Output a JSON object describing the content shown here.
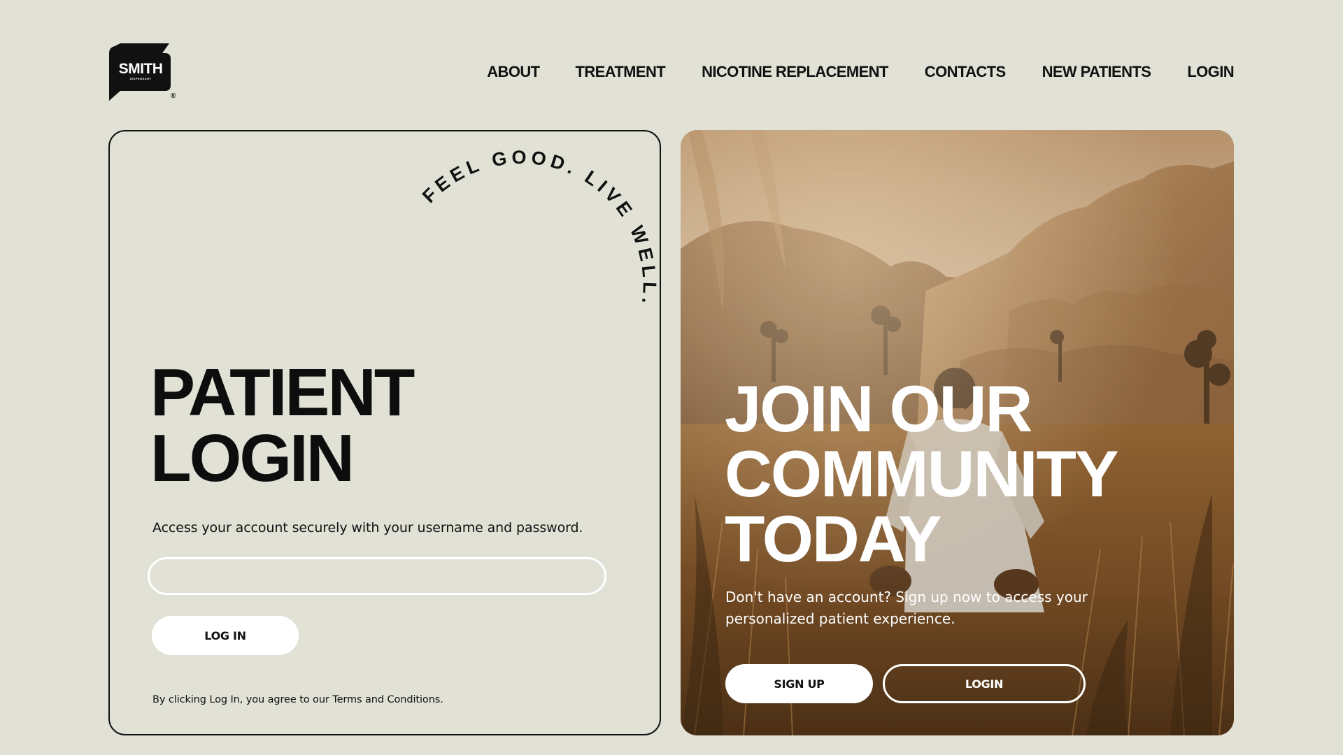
{
  "brand": {
    "logo_main": "SMITH",
    "logo_sub": "DISPENSARY",
    "logo_reg": "®"
  },
  "nav": {
    "items": [
      {
        "label": "ABOUT"
      },
      {
        "label": "TREATMENT"
      },
      {
        "label": "NICOTINE REPLACEMENT"
      },
      {
        "label": "CONTACTS"
      },
      {
        "label": "NEW PATIENTS"
      },
      {
        "label": "LOGIN"
      }
    ]
  },
  "login": {
    "tagline": "FEEL GOOD. LIVE WELL.",
    "title_line1": "PATIENT",
    "title_line2": "LOGIN",
    "description": "Access your account securely with your username and password.",
    "username_value": "",
    "login_button": "LOG IN",
    "terms": "By clicking Log In, you agree to our Terms and Conditions."
  },
  "community": {
    "title_line1": "JOIN OUR",
    "title_line2": "COMMUNITY",
    "title_line3": "TODAY",
    "description": "Don't have an account? Sign up now to access your personalized patient experience.",
    "signup_button": "SIGN UP",
    "login_button": "LOGIN"
  },
  "colors": {
    "background": "#e2e1d6",
    "text": "#111111",
    "button_bg": "#ffffff",
    "photo_warm": "#b8874f"
  },
  "icons": [
    "logo-bolt-icon"
  ]
}
